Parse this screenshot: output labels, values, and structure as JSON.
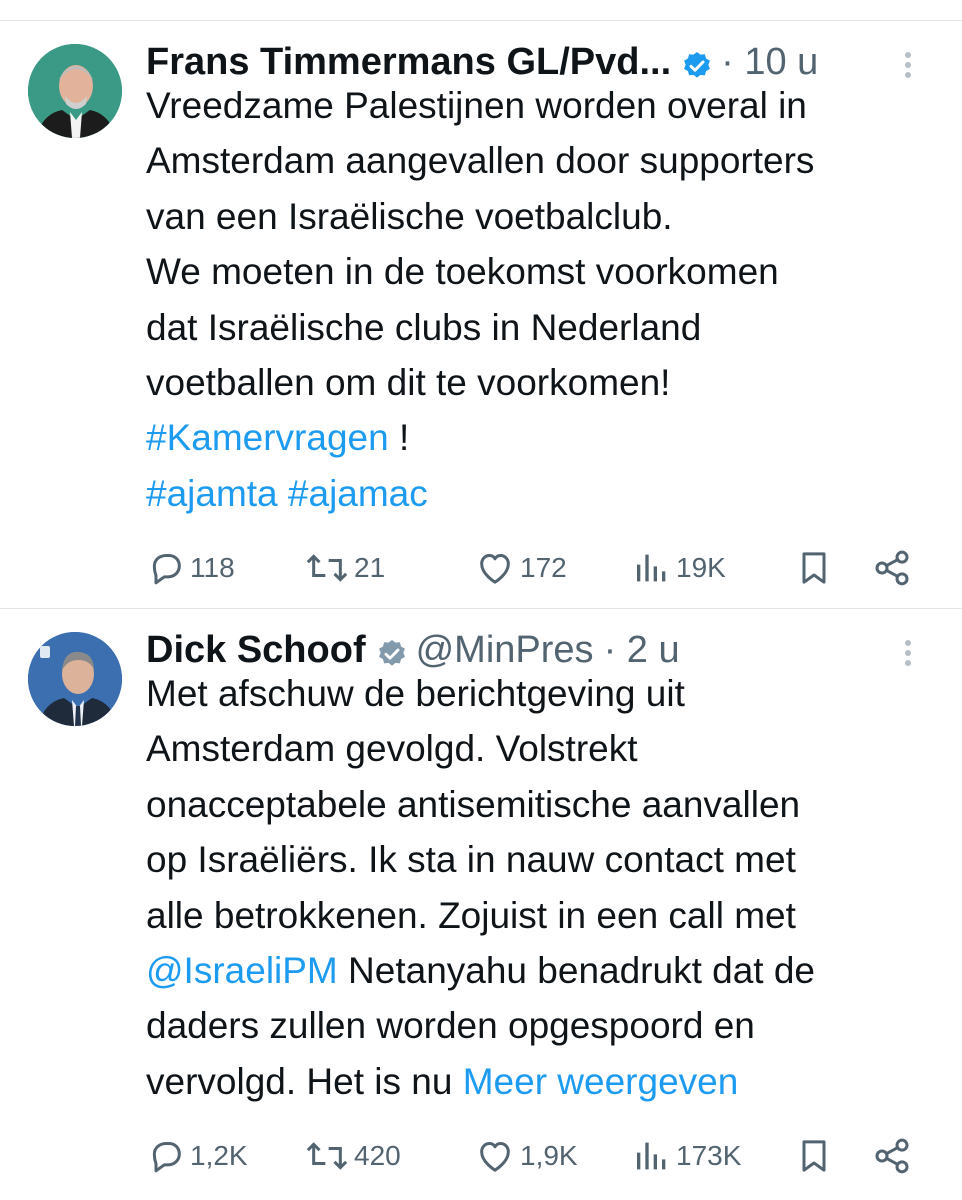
{
  "tweets": [
    {
      "author": "Frans Timmermans GL/Pvd...",
      "handle": "",
      "time": "· 10 u",
      "text_lines": [
        {
          "parts": [
            {
              "t": "Vreedzame Palestijnen worden overal in",
              "link": false
            }
          ]
        },
        {
          "parts": [
            {
              "t": "Amsterdam aangevallen door supporters",
              "link": false
            }
          ]
        },
        {
          "parts": [
            {
              "t": "van een Israëlische voetbalclub.",
              "link": false
            }
          ]
        },
        {
          "parts": [
            {
              "t": "We moeten in de toekomst voorkomen",
              "link": false
            }
          ]
        },
        {
          "parts": [
            {
              "t": "dat Israëlische clubs in Nederland",
              "link": false
            }
          ]
        },
        {
          "parts": [
            {
              "t": "voetballen om dit te voorkomen!",
              "link": false
            }
          ]
        },
        {
          "parts": [
            {
              "t": "#Kamervragen",
              "link": true
            },
            {
              "t": " !",
              "link": false
            }
          ]
        },
        {
          "parts": [
            {
              "t": "#ajamta #ajamac",
              "link": true
            }
          ]
        }
      ],
      "replies": "118",
      "reposts": "21",
      "likes": "172",
      "views": "19K"
    },
    {
      "author": "Dick Schoof",
      "handle": "@MinPres",
      "time": "· 2 u",
      "text_lines": [
        {
          "parts": [
            {
              "t": "Met afschuw de berichtgeving uit",
              "link": false
            }
          ]
        },
        {
          "parts": [
            {
              "t": "Amsterdam gevolgd. Volstrekt",
              "link": false
            }
          ]
        },
        {
          "parts": [
            {
              "t": "onacceptabele antisemitische aanvallen",
              "link": false
            }
          ]
        },
        {
          "parts": [
            {
              "t": "op Israëliërs. Ik sta in nauw contact met",
              "link": false
            }
          ]
        },
        {
          "parts": [
            {
              "t": "alle betrokkenen. Zojuist in een call met",
              "link": false
            }
          ]
        },
        {
          "parts": [
            {
              "t": "@IsraeliPM",
              "link": true
            },
            {
              "t": " Netanyahu benadrukt dat de",
              "link": false
            }
          ]
        },
        {
          "parts": [
            {
              "t": "daders zullen worden opgespoord en",
              "link": false
            }
          ]
        },
        {
          "parts": [
            {
              "t": "vervolgd. Het is nu ",
              "link": false
            },
            {
              "t": "Meer weergeven",
              "link": true
            }
          ]
        }
      ],
      "replies": "1,2K",
      "reposts": "420",
      "likes": "1,9K",
      "views": "173K"
    }
  ],
  "colors": {
    "link": "#1d9bf0",
    "muted": "#536471",
    "verified_blue": "#1d9bf0",
    "verified_gray": "#829aab"
  },
  "icons": [
    "reply-icon",
    "repost-icon",
    "like-icon",
    "views-icon",
    "bookmark-icon",
    "share-icon",
    "more-icon",
    "verified-icon"
  ]
}
